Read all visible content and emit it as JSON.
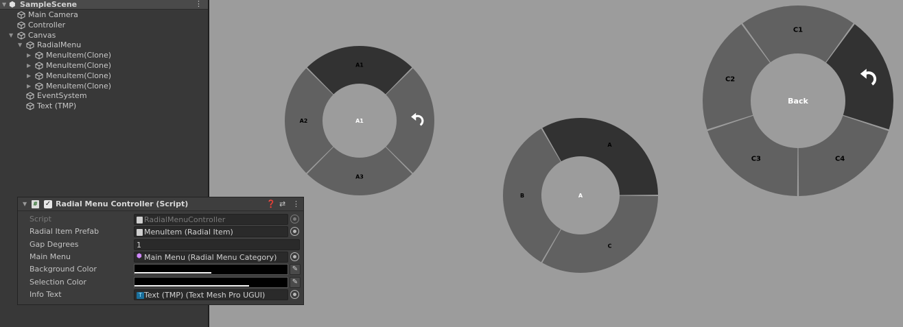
{
  "hierarchy": {
    "scene_name": "SampleScene",
    "items": [
      {
        "label": "Main Camera"
      },
      {
        "label": "Controller"
      },
      {
        "label": "Canvas"
      },
      {
        "label": "RadialMenu"
      },
      {
        "label": "MenuItem(Clone)"
      },
      {
        "label": "MenuItem(Clone)"
      },
      {
        "label": "MenuItem(Clone)"
      },
      {
        "label": "MenuItem(Clone)"
      },
      {
        "label": "EventSystem"
      },
      {
        "label": "Text (TMP)"
      }
    ]
  },
  "inspector": {
    "component_title": "Radial Menu Controller (Script)",
    "properties": {
      "script": {
        "label": "Script",
        "value": "RadialMenuController"
      },
      "radial_item_prefab": {
        "label": "Radial Item Prefab",
        "value": "MenuItem (Radial Item)"
      },
      "gap_degrees": {
        "label": "Gap Degrees",
        "value": "1"
      },
      "main_menu": {
        "label": "Main Menu",
        "value": "Main Menu (Radial Menu Category)"
      },
      "background_color": {
        "label": "Background Color",
        "alpha": 0.5
      },
      "selection_color": {
        "label": "Selection Color",
        "alpha": 0.75
      },
      "info_text": {
        "label": "Info Text",
        "value": "Text (TMP) (Text Mesh Pro UGUI)"
      }
    }
  },
  "scene_view": {
    "background_color": "#9c9c9c",
    "menus": [
      {
        "center_label": "A1",
        "items": [
          {
            "label": "A1",
            "selected": true
          },
          {
            "label": "",
            "icon": "back-arrow-icon",
            "selected": false
          },
          {
            "label": "A3",
            "selected": false
          },
          {
            "label": "A2",
            "selected": false
          }
        ]
      },
      {
        "center_label": "A",
        "items": [
          {
            "label": "A",
            "selected": true
          },
          {
            "label": "C",
            "selected": false
          },
          {
            "label": "B",
            "selected": false
          }
        ]
      },
      {
        "center_label": "Back",
        "items": [
          {
            "label": "C1",
            "selected": false
          },
          {
            "label": "",
            "icon": "back-arrow-icon",
            "selected": true
          },
          {
            "label": "C4",
            "selected": false
          },
          {
            "label": "C3",
            "selected": false
          },
          {
            "label": "C2",
            "selected": false
          }
        ]
      }
    ],
    "colors": {
      "segment": "#616161",
      "selected": "#323232",
      "label": "#000000",
      "center_label": "#ffffff",
      "gap": "#9c9c9c"
    }
  }
}
